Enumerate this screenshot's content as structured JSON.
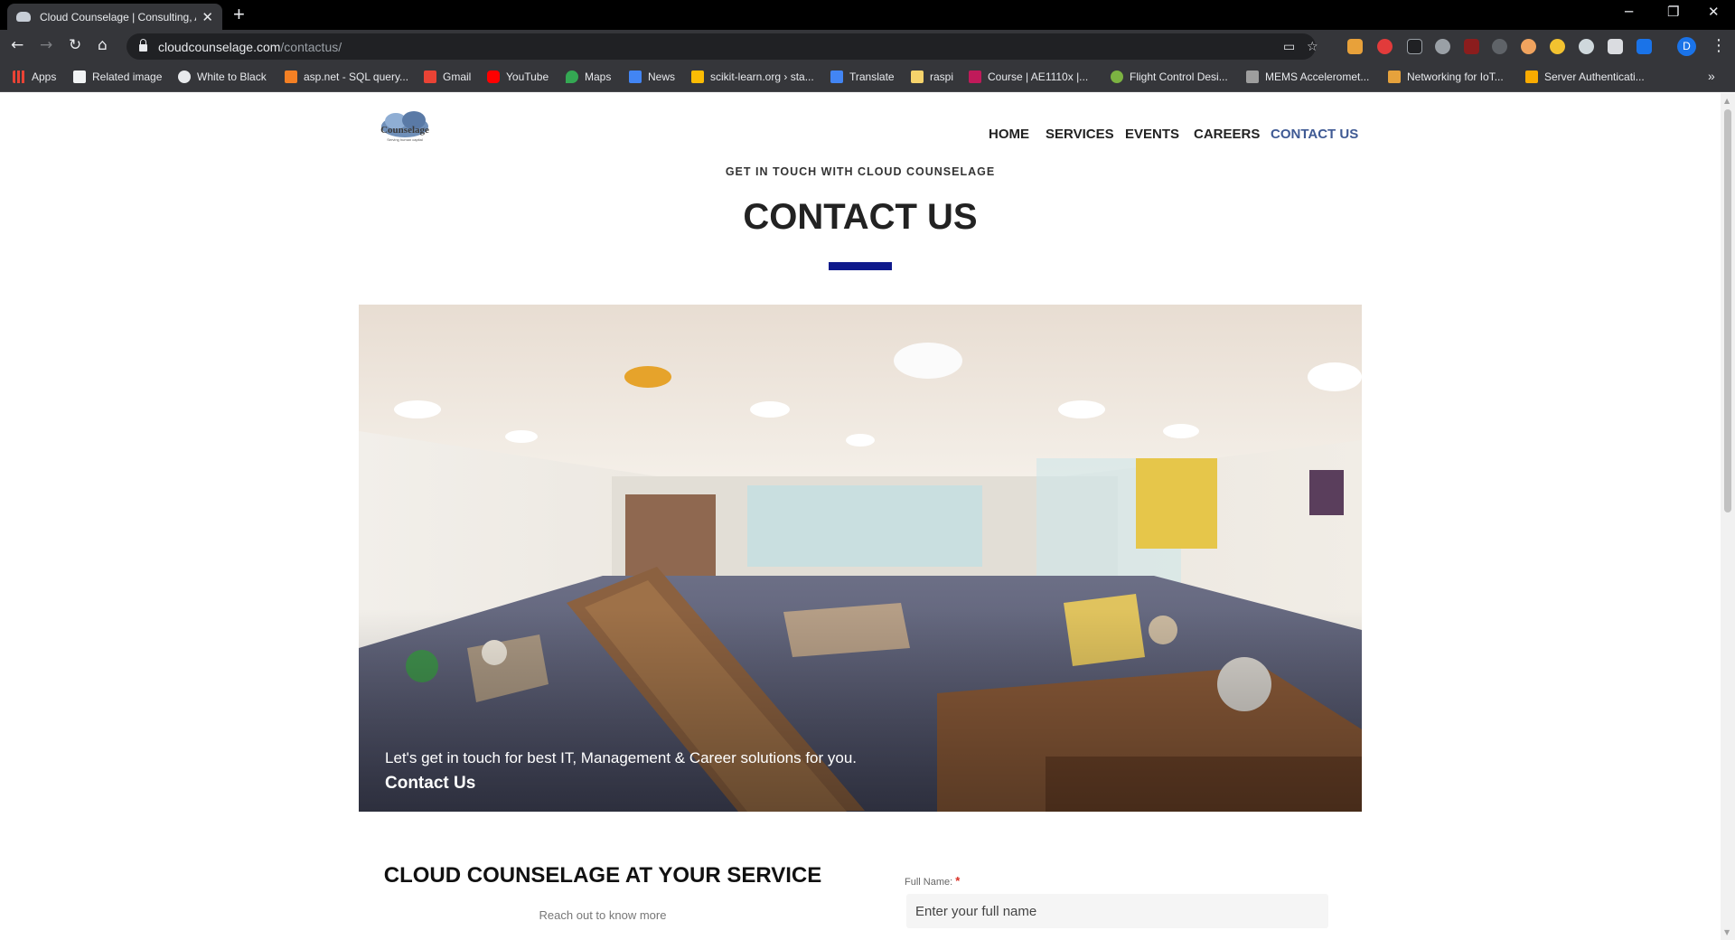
{
  "browser": {
    "tab_title": "Cloud Counselage | Consulting, A",
    "url_host": "cloudcounselage.com",
    "url_path": "/contactus/",
    "profile_initial": "D",
    "bookmarks": [
      "Apps",
      "Related image",
      "White to Black",
      "asp.net - SQL query...",
      "Gmail",
      "YouTube",
      "Maps",
      "News",
      "scikit-learn.org › sta...",
      "Translate",
      "raspi",
      "Course | AE1110x |...",
      "Flight Control Desi...",
      "MEMS Acceleromet...",
      "Networking for IoT...",
      "Server Authenticati..."
    ]
  },
  "site": {
    "logo_text": "Counselage",
    "logo_tagline": "Serving human capital",
    "nav": [
      "HOME",
      "SERVICES",
      "EVENTS",
      "CAREERS",
      "CONTACT US"
    ],
    "eyebrow": "GET IN TOUCH WITH CLOUD COUNSELAGE",
    "title": "CONTACT US",
    "hero_caption": "Let's get in touch for best IT, Management & Career solutions for you.",
    "hero_sub": "Contact Us",
    "service_title": "CLOUD COUNSELAGE AT YOUR SERVICE",
    "service_sub": "Reach out to know more",
    "form": {
      "full_name_label": "Full Name:",
      "required_mark": "*",
      "full_name_placeholder": "Enter your full name"
    }
  },
  "colors": {
    "accent_bar": "#0f1a8c",
    "active_nav": "#3f5a94",
    "required": "#d93025"
  }
}
